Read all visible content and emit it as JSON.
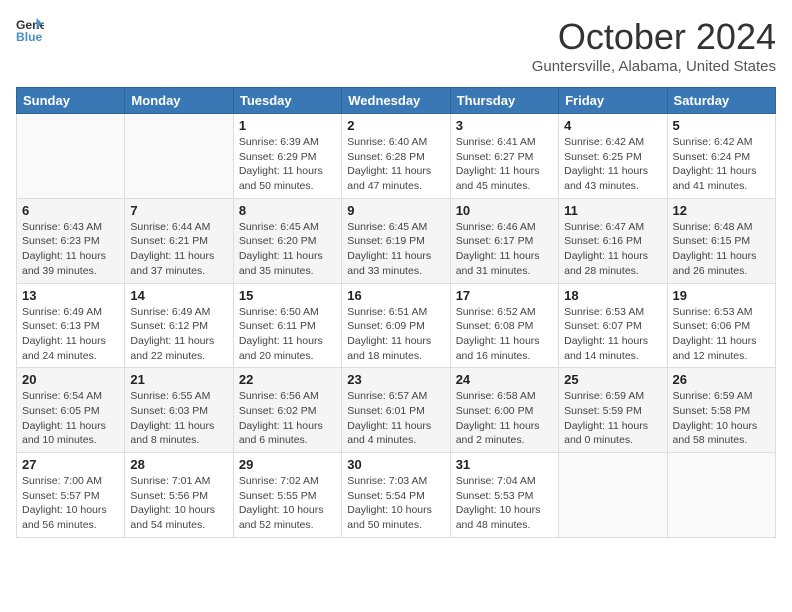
{
  "header": {
    "logo_line1": "General",
    "logo_line2": "Blue",
    "title": "October 2024",
    "subtitle": "Guntersville, Alabama, United States"
  },
  "columns": [
    "Sunday",
    "Monday",
    "Tuesday",
    "Wednesday",
    "Thursday",
    "Friday",
    "Saturday"
  ],
  "weeks": [
    [
      {
        "day": "",
        "detail": ""
      },
      {
        "day": "",
        "detail": ""
      },
      {
        "day": "1",
        "detail": "Sunrise: 6:39 AM\nSunset: 6:29 PM\nDaylight: 11 hours and 50 minutes."
      },
      {
        "day": "2",
        "detail": "Sunrise: 6:40 AM\nSunset: 6:28 PM\nDaylight: 11 hours and 47 minutes."
      },
      {
        "day": "3",
        "detail": "Sunrise: 6:41 AM\nSunset: 6:27 PM\nDaylight: 11 hours and 45 minutes."
      },
      {
        "day": "4",
        "detail": "Sunrise: 6:42 AM\nSunset: 6:25 PM\nDaylight: 11 hours and 43 minutes."
      },
      {
        "day": "5",
        "detail": "Sunrise: 6:42 AM\nSunset: 6:24 PM\nDaylight: 11 hours and 41 minutes."
      }
    ],
    [
      {
        "day": "6",
        "detail": "Sunrise: 6:43 AM\nSunset: 6:23 PM\nDaylight: 11 hours and 39 minutes."
      },
      {
        "day": "7",
        "detail": "Sunrise: 6:44 AM\nSunset: 6:21 PM\nDaylight: 11 hours and 37 minutes."
      },
      {
        "day": "8",
        "detail": "Sunrise: 6:45 AM\nSunset: 6:20 PM\nDaylight: 11 hours and 35 minutes."
      },
      {
        "day": "9",
        "detail": "Sunrise: 6:45 AM\nSunset: 6:19 PM\nDaylight: 11 hours and 33 minutes."
      },
      {
        "day": "10",
        "detail": "Sunrise: 6:46 AM\nSunset: 6:17 PM\nDaylight: 11 hours and 31 minutes."
      },
      {
        "day": "11",
        "detail": "Sunrise: 6:47 AM\nSunset: 6:16 PM\nDaylight: 11 hours and 28 minutes."
      },
      {
        "day": "12",
        "detail": "Sunrise: 6:48 AM\nSunset: 6:15 PM\nDaylight: 11 hours and 26 minutes."
      }
    ],
    [
      {
        "day": "13",
        "detail": "Sunrise: 6:49 AM\nSunset: 6:13 PM\nDaylight: 11 hours and 24 minutes."
      },
      {
        "day": "14",
        "detail": "Sunrise: 6:49 AM\nSunset: 6:12 PM\nDaylight: 11 hours and 22 minutes."
      },
      {
        "day": "15",
        "detail": "Sunrise: 6:50 AM\nSunset: 6:11 PM\nDaylight: 11 hours and 20 minutes."
      },
      {
        "day": "16",
        "detail": "Sunrise: 6:51 AM\nSunset: 6:09 PM\nDaylight: 11 hours and 18 minutes."
      },
      {
        "day": "17",
        "detail": "Sunrise: 6:52 AM\nSunset: 6:08 PM\nDaylight: 11 hours and 16 minutes."
      },
      {
        "day": "18",
        "detail": "Sunrise: 6:53 AM\nSunset: 6:07 PM\nDaylight: 11 hours and 14 minutes."
      },
      {
        "day": "19",
        "detail": "Sunrise: 6:53 AM\nSunset: 6:06 PM\nDaylight: 11 hours and 12 minutes."
      }
    ],
    [
      {
        "day": "20",
        "detail": "Sunrise: 6:54 AM\nSunset: 6:05 PM\nDaylight: 11 hours and 10 minutes."
      },
      {
        "day": "21",
        "detail": "Sunrise: 6:55 AM\nSunset: 6:03 PM\nDaylight: 11 hours and 8 minutes."
      },
      {
        "day": "22",
        "detail": "Sunrise: 6:56 AM\nSunset: 6:02 PM\nDaylight: 11 hours and 6 minutes."
      },
      {
        "day": "23",
        "detail": "Sunrise: 6:57 AM\nSunset: 6:01 PM\nDaylight: 11 hours and 4 minutes."
      },
      {
        "day": "24",
        "detail": "Sunrise: 6:58 AM\nSunset: 6:00 PM\nDaylight: 11 hours and 2 minutes."
      },
      {
        "day": "25",
        "detail": "Sunrise: 6:59 AM\nSunset: 5:59 PM\nDaylight: 11 hours and 0 minutes."
      },
      {
        "day": "26",
        "detail": "Sunrise: 6:59 AM\nSunset: 5:58 PM\nDaylight: 10 hours and 58 minutes."
      }
    ],
    [
      {
        "day": "27",
        "detail": "Sunrise: 7:00 AM\nSunset: 5:57 PM\nDaylight: 10 hours and 56 minutes."
      },
      {
        "day": "28",
        "detail": "Sunrise: 7:01 AM\nSunset: 5:56 PM\nDaylight: 10 hours and 54 minutes."
      },
      {
        "day": "29",
        "detail": "Sunrise: 7:02 AM\nSunset: 5:55 PM\nDaylight: 10 hours and 52 minutes."
      },
      {
        "day": "30",
        "detail": "Sunrise: 7:03 AM\nSunset: 5:54 PM\nDaylight: 10 hours and 50 minutes."
      },
      {
        "day": "31",
        "detail": "Sunrise: 7:04 AM\nSunset: 5:53 PM\nDaylight: 10 hours and 48 minutes."
      },
      {
        "day": "",
        "detail": ""
      },
      {
        "day": "",
        "detail": ""
      }
    ]
  ]
}
